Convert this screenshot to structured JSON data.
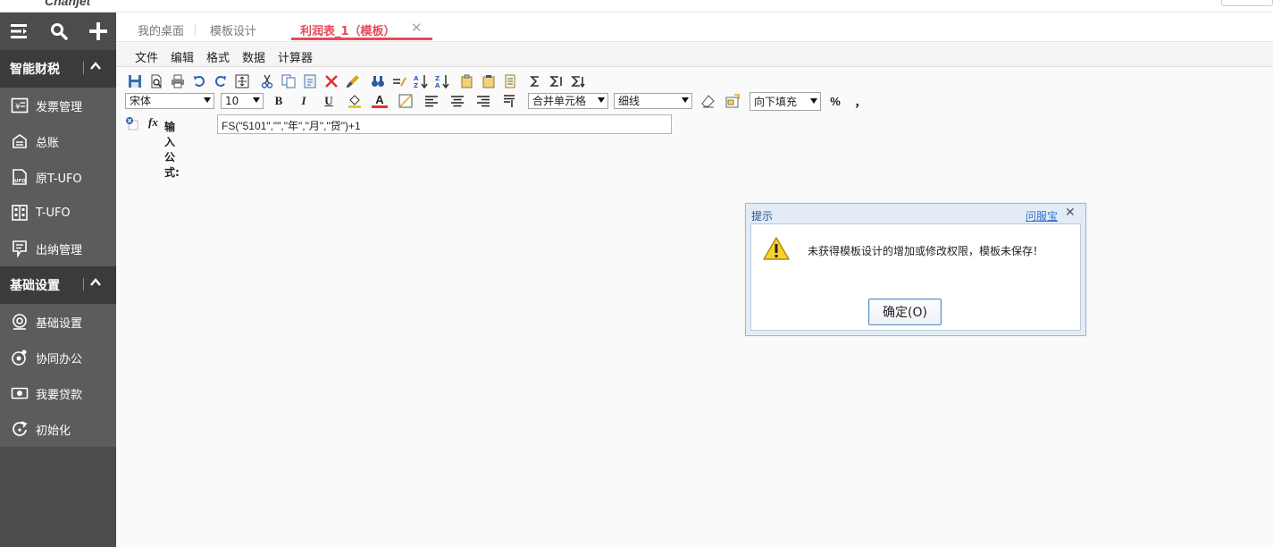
{
  "brand": {
    "logo_text": "Chanjet"
  },
  "sidebar": {
    "tools": [
      {
        "name": "menu-icon"
      },
      {
        "name": "search-icon"
      },
      {
        "name": "plus-icon"
      }
    ],
    "sections": [
      {
        "title": "智能财税",
        "items": [
          {
            "label": "发票管理",
            "icon": "invoice-icon"
          },
          {
            "label": "总账",
            "icon": "ledger-icon"
          },
          {
            "label": "原T-UFO",
            "icon": "ufo-icon"
          },
          {
            "label": "T-UFO",
            "icon": "building-icon"
          },
          {
            "label": "出纳管理",
            "icon": "cashier-icon"
          }
        ]
      },
      {
        "title": "基础设置",
        "items": [
          {
            "label": "基础设置",
            "icon": "settings-icon"
          },
          {
            "label": "协同办公",
            "icon": "collab-icon"
          },
          {
            "label": "我要贷款",
            "icon": "loan-icon"
          },
          {
            "label": "初始化",
            "icon": "init-icon"
          }
        ]
      }
    ]
  },
  "tabs": {
    "items": [
      {
        "label": "我的桌面"
      },
      {
        "label": "模板设计"
      },
      {
        "label": "利润表_1（模板）"
      }
    ],
    "close_symbol": "✕"
  },
  "menu": {
    "items": [
      "文件",
      "编辑",
      "格式",
      "数据",
      "计算器"
    ]
  },
  "format_toolbar": {
    "font": "宋体",
    "size": "10",
    "bold": "B",
    "italic": "I",
    "underline": "U",
    "font_color_glyph": "A",
    "merge": "合并单元格",
    "border": "细线",
    "fill": "向下填充",
    "percent": "%",
    "comma": "，"
  },
  "formula": {
    "fx_glyph": "fx",
    "label": "输入公式:",
    "value": "FS(\"5101\",\"\",\"年\",\"月\",\"贷\")+1"
  },
  "dialog": {
    "title": "提示",
    "help_link": "问服宝",
    "close_symbol": "✕",
    "message": "未获得模板设计的增加或修改权限，模板未保存！",
    "ok_label": "确定(O)"
  },
  "colors": {
    "sidebar_bg": "#4a4c4e",
    "sidebar_section_bg": "#393b3d",
    "active_tab": "#e84a5a",
    "dialog_title": "#1f4f88",
    "link": "#2f6fd0"
  }
}
